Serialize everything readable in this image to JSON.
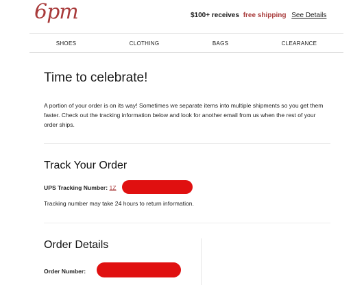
{
  "brand": {
    "logo_text": "6pm"
  },
  "promo": {
    "amount": "$100+ receives",
    "free": "free shipping",
    "details": "See Details"
  },
  "nav": {
    "items": [
      "SHOES",
      "CLOTHING",
      "BAGS",
      "CLEARANCE"
    ]
  },
  "celebrate": {
    "title": "Time to celebrate!",
    "body": "A portion of your order is on its way! Sometimes we separate items into multiple shipments so you get them faster. Check out the tracking information below and look for another email from us when the rest of your order ships."
  },
  "tracking": {
    "title": "Track Your Order",
    "label": "UPS Tracking Number:",
    "number_prefix": "1Z",
    "note": "Tracking number may take 24 hours to return information."
  },
  "order": {
    "title": "Order Details",
    "number_label": "Order Number:"
  },
  "colors": {
    "brand": "#a83a3a",
    "redaction": "#e01010"
  }
}
